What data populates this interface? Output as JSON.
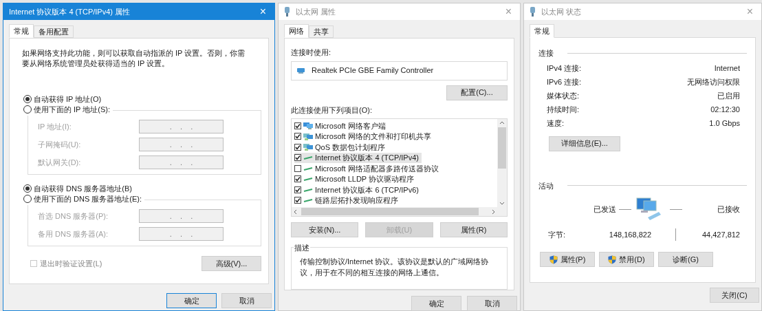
{
  "ipv4_window": {
    "title": "Internet 协议版本 4 (TCP/IPv4) 属性",
    "active": true,
    "close": "×",
    "tabs": [
      {
        "label": "常规",
        "selected": true
      },
      {
        "label": "备用配置",
        "selected": false
      }
    ],
    "intro": "如果网络支持此功能，则可以获取自动指派的 IP 设置。否则，你需要从网络系统管理员处获得适当的 IP 设置。",
    "ip_options": [
      {
        "label": "自动获得 IP 地址(O)",
        "selected": true
      },
      {
        "label": "使用下面的 IP 地址(S):",
        "selected": false
      }
    ],
    "ip_fields": [
      {
        "label": "IP 地址(I):",
        "value": ".    .    .",
        "disabled": true
      },
      {
        "label": "子网掩码(U):",
        "value": ".    .    .",
        "disabled": true
      },
      {
        "label": "默认网关(D):",
        "value": ".    .    .",
        "disabled": true
      }
    ],
    "dns_options": [
      {
        "label": "自动获得 DNS 服务器地址(B)",
        "selected": true
      },
      {
        "label": "使用下面的 DNS 服务器地址(E):",
        "selected": false
      }
    ],
    "dns_fields": [
      {
        "label": "首选 DNS 服务器(P):",
        "value": ".    .    .",
        "disabled": true
      },
      {
        "label": "备用 DNS 服务器(A):",
        "value": ".    .    .",
        "disabled": true
      }
    ],
    "validate_checkbox": {
      "label": "退出时验证设置(L)",
      "checked": false,
      "disabled": true
    },
    "advanced_button": "高级(V)...",
    "buttons": [
      {
        "label": "确定",
        "default": true
      },
      {
        "label": "取消",
        "default": false
      }
    ]
  },
  "ethernet_properties": {
    "title": "以太网 属性",
    "active": false,
    "close": "×",
    "tabs": [
      {
        "label": "网络",
        "selected": true
      },
      {
        "label": "共享",
        "selected": false
      }
    ],
    "connect_using_label": "连接时使用:",
    "adapter": "Realtek PCIe GBE Family Controller",
    "configure_button": "配置(C)...",
    "items_label": "此连接使用下列项目(O):",
    "items": [
      {
        "label": "Microsoft 网络客户端",
        "kind": "client",
        "checked": true,
        "selected": false
      },
      {
        "label": "Microsoft 网络的文件和打印机共享",
        "kind": "service",
        "checked": true,
        "selected": false
      },
      {
        "label": "QoS 数据包计划程序",
        "kind": "service",
        "checked": true,
        "selected": false
      },
      {
        "label": "Internet 协议版本 4 (TCP/IPv4)",
        "kind": "protocol",
        "checked": true,
        "selected": true
      },
      {
        "label": "Microsoft 网络适配器多路传送器协议",
        "kind": "protocol",
        "checked": false,
        "selected": false
      },
      {
        "label": "Microsoft LLDP 协议驱动程序",
        "kind": "protocol",
        "checked": true,
        "selected": false
      },
      {
        "label": "Internet 协议版本 6 (TCP/IPv6)",
        "kind": "protocol",
        "checked": true,
        "selected": false
      },
      {
        "label": "链路层拓扑发现响应程序",
        "kind": "protocol",
        "checked": true,
        "selected": false
      }
    ],
    "item_buttons": [
      {
        "label": "安装(N)...",
        "disabled": false
      },
      {
        "label": "卸载(U)",
        "disabled": true
      },
      {
        "label": "属性(R)",
        "disabled": false
      }
    ],
    "description_title": "描述",
    "description": "传输控制协议/Internet 协议。该协议是默认的广域网络协议，用于在不同的相互连接的网络上通信。",
    "buttons": [
      {
        "label": "确定",
        "default": false
      },
      {
        "label": "取消",
        "default": false
      }
    ]
  },
  "ethernet_status": {
    "title": "以太网 状态",
    "active": false,
    "close": "×",
    "tabs": [
      {
        "label": "常规",
        "selected": true
      }
    ],
    "connection_heading": "连接",
    "connection_rows": [
      {
        "label": "IPv4 连接:",
        "value": "Internet"
      },
      {
        "label": "IPv6 连接:",
        "value": "无网络访问权限"
      },
      {
        "label": "媒体状态:",
        "value": "已启用"
      },
      {
        "label": "持续时间:",
        "value": "02:12:30"
      },
      {
        "label": "速度:",
        "value": "1.0 Gbps"
      }
    ],
    "details_button": "详细信息(E)...",
    "activity_heading": "活动",
    "sent_label": "已发送",
    "received_label": "已接收",
    "bytes_label": "字节:",
    "bytes_sent": "148,168,822",
    "bytes_received": "44,427,812",
    "buttons": [
      {
        "label": "属性(P)",
        "shield": true
      },
      {
        "label": "禁用(D)",
        "shield": true
      },
      {
        "label": "诊断(G)",
        "shield": false
      }
    ],
    "close_button": "关闭(C)"
  }
}
